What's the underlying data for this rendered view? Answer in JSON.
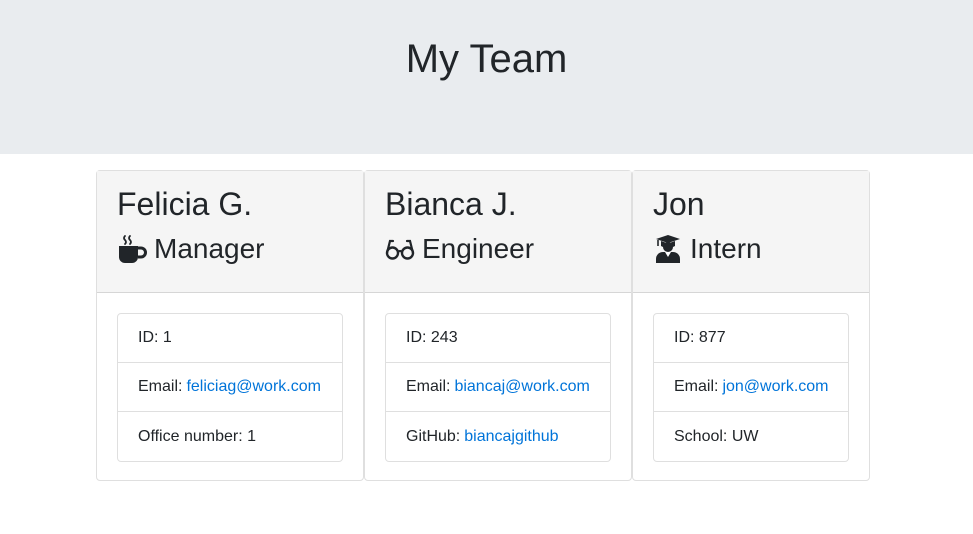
{
  "header": {
    "title": "My Team"
  },
  "colors": {
    "jumbotron_bg": "#e9ecef",
    "card_header_bg": "#f5f5f5",
    "link": "#0074d9"
  },
  "cards": [
    {
      "name": "Felicia G.",
      "role": "Manager",
      "icon": "mug-hot-icon",
      "id_label": "ID: 1",
      "email_prefix": "Email:",
      "email": "feliciag@work.com",
      "extra_label": "Office number: 1"
    },
    {
      "name": "Bianca J.",
      "role": "Engineer",
      "icon": "glasses-icon",
      "id_label": "ID: 243",
      "email_prefix": "Email:",
      "email": "biancaj@work.com",
      "extra_prefix": "GitHub:",
      "extra_link": "biancajgithub"
    },
    {
      "name": "Jon",
      "role": "Intern",
      "icon": "graduate-icon",
      "id_label": "ID: 877",
      "email_prefix": "Email:",
      "email": "jon@work.com",
      "extra_label": "School: UW"
    }
  ]
}
